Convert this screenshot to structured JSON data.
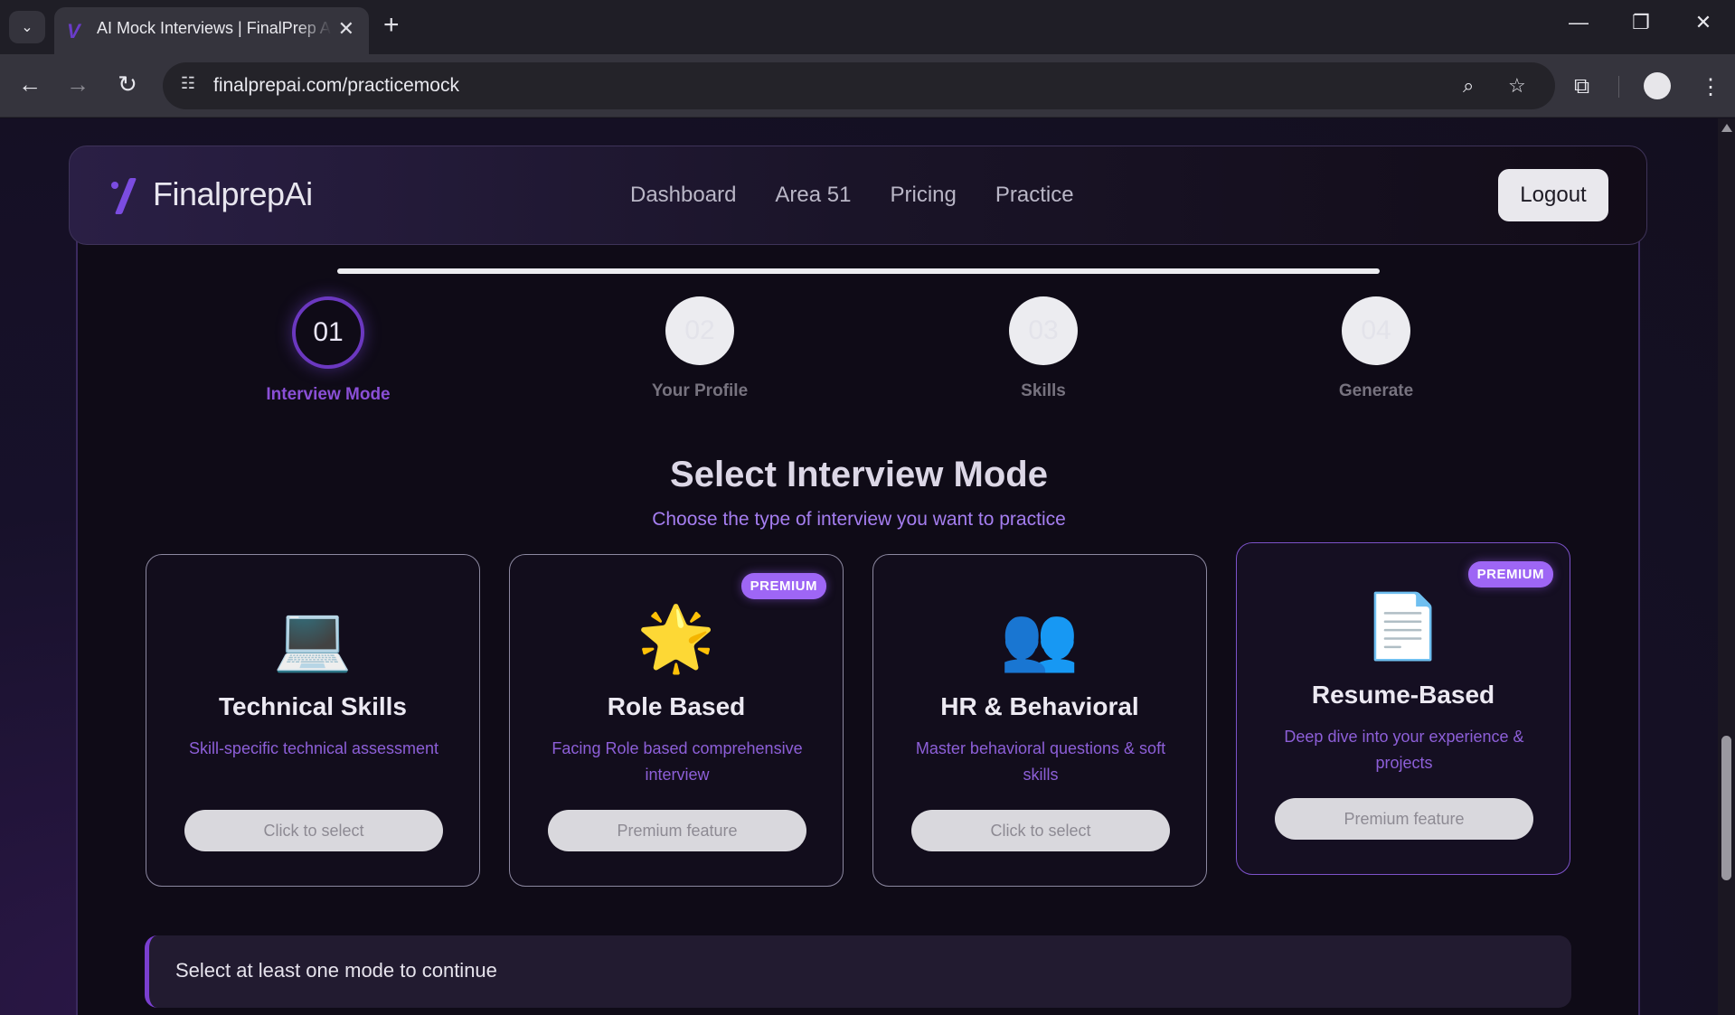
{
  "browser": {
    "tab_title": "AI Mock Interviews | FinalPrep AI",
    "url": "finalprepai.com/practicemock"
  },
  "navbar": {
    "brand": "FinalprepAi",
    "links": [
      "Dashboard",
      "Area 51",
      "Pricing",
      "Practice"
    ],
    "logout_label": "Logout"
  },
  "steps": [
    {
      "number": "01",
      "label": "Interview Mode",
      "active": true
    },
    {
      "number": "02",
      "label": "Your Profile",
      "active": false
    },
    {
      "number": "03",
      "label": "Skills",
      "active": false
    },
    {
      "number": "04",
      "label": "Generate",
      "active": false
    }
  ],
  "section": {
    "title": "Select Interview Mode",
    "subtitle": "Choose the type of interview you want to practice"
  },
  "cards": [
    {
      "icon": "laptop-icon",
      "glyph": "💻",
      "title": "Technical Skills",
      "desc": "Skill-specific technical assessment",
      "button": "Click to select",
      "badge": ""
    },
    {
      "icon": "star-icon",
      "glyph": "🌟",
      "title": "Role Based",
      "desc": "Facing Role based comprehensive interview",
      "button": "Premium feature",
      "badge": "PREMIUM"
    },
    {
      "icon": "people-icon",
      "glyph": "👥",
      "title": "HR & Behavioral",
      "desc": "Master behavioral questions & soft skills",
      "button": "Click to select",
      "badge": ""
    },
    {
      "icon": "document-icon",
      "glyph": "📄",
      "title": "Resume-Based",
      "desc": "Deep dive into your experience & projects",
      "button": "Premium feature",
      "badge": "PREMIUM"
    }
  ],
  "notice": "Select at least one mode to continue",
  "colors": {
    "accent": "#7b4ce0",
    "premium_badge": "#9e66f5",
    "subtitle": "#a57ef0"
  }
}
